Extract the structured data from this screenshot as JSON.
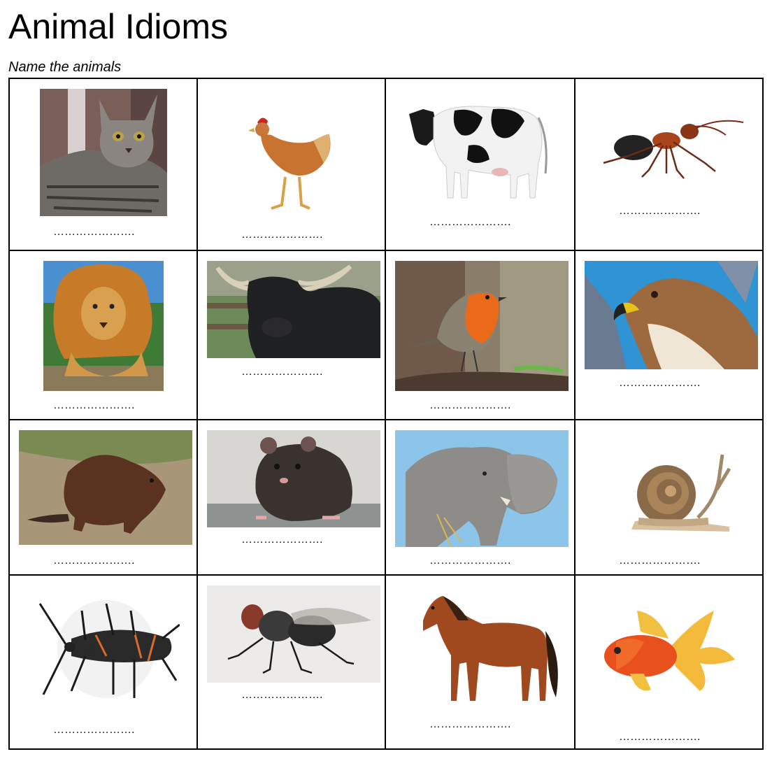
{
  "title": "Animal Idioms",
  "subtitle": "Name the animals",
  "blank": "………………….",
  "animals": [
    {
      "icon": "cat-icon"
    },
    {
      "icon": "hen-icon"
    },
    {
      "icon": "cow-icon"
    },
    {
      "icon": "ant-icon"
    },
    {
      "icon": "lion-icon"
    },
    {
      "icon": "bull-icon"
    },
    {
      "icon": "robin-icon"
    },
    {
      "icon": "hawk-icon"
    },
    {
      "icon": "beaver-icon"
    },
    {
      "icon": "rat-icon"
    },
    {
      "icon": "elephant-icon"
    },
    {
      "icon": "snail-icon"
    },
    {
      "icon": "bug-icon"
    },
    {
      "icon": "fly-icon"
    },
    {
      "icon": "horse-icon"
    },
    {
      "icon": "goldfish-icon"
    }
  ]
}
